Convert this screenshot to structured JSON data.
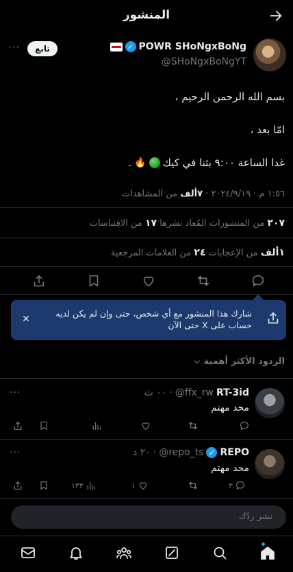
{
  "header": {
    "title": "المنشور"
  },
  "post": {
    "author_name": "POWR SHoNgxBoNg",
    "author_handle": "@SHoNgxBoNgYT",
    "follow_label": "تابع",
    "more_label": "···",
    "lines": [
      "بسم الله الرحمن الرحيم ،",
      "امّا بعد ،",
      "غدا الساعة ٩:٠٠ بثنا في كيك"
    ],
    "line3_tail": ".",
    "meta_date": "١:٥٦ م · ٢٠٢٤/٩/١٩ · ",
    "meta_views": "٧ألف",
    "meta_views_label": " من المشاهدات",
    "reposts_count": "٢٠٧",
    "reposts_label": " من المنشورات المُعاد نشرها ",
    "quotes_count": "١٧",
    "quotes_label": " من الاقتباسات",
    "likes_count": "١ألف",
    "likes_label": " من الإعجابات ",
    "bookmarks_count": "٢٤",
    "bookmarks_label": " من العلامات المرجعية"
  },
  "share_tip": {
    "text": "شارك هذا المنشور مع أي شخص، حتى وإن لم يكن لديه حساب على X حتى الآن",
    "close": "✕"
  },
  "replies_sort": {
    "label": "الردود الأكثر أهمية"
  },
  "replies": [
    {
      "name": "RT-3id",
      "handle": "@ffx_rw",
      "time": "٠٠ ث",
      "text": "محد مهتم",
      "more": "···",
      "verified": false,
      "replies_count": "",
      "likes_count": "",
      "views_count": ""
    },
    {
      "name": "REPO",
      "handle": "@repo_ts",
      "time": "٢٠ د",
      "text": "محد مهتم",
      "more": "···",
      "verified": true,
      "replies_count": "٣",
      "likes_count": "١",
      "views_count": "١٣٣"
    }
  ],
  "reply_box": {
    "placeholder": "نشر ردّك"
  },
  "icons": {
    "back": "arrow-right-icon",
    "verified": "verified-badge-icon",
    "nav": [
      "mail-icon",
      "bell-icon",
      "communities-icon",
      "grok-icon",
      "search-icon",
      "home-icon"
    ]
  },
  "colors": {
    "accent": "#1d9bf0",
    "tooltip_bg": "#1c3a6e",
    "muted": "#71767b"
  }
}
